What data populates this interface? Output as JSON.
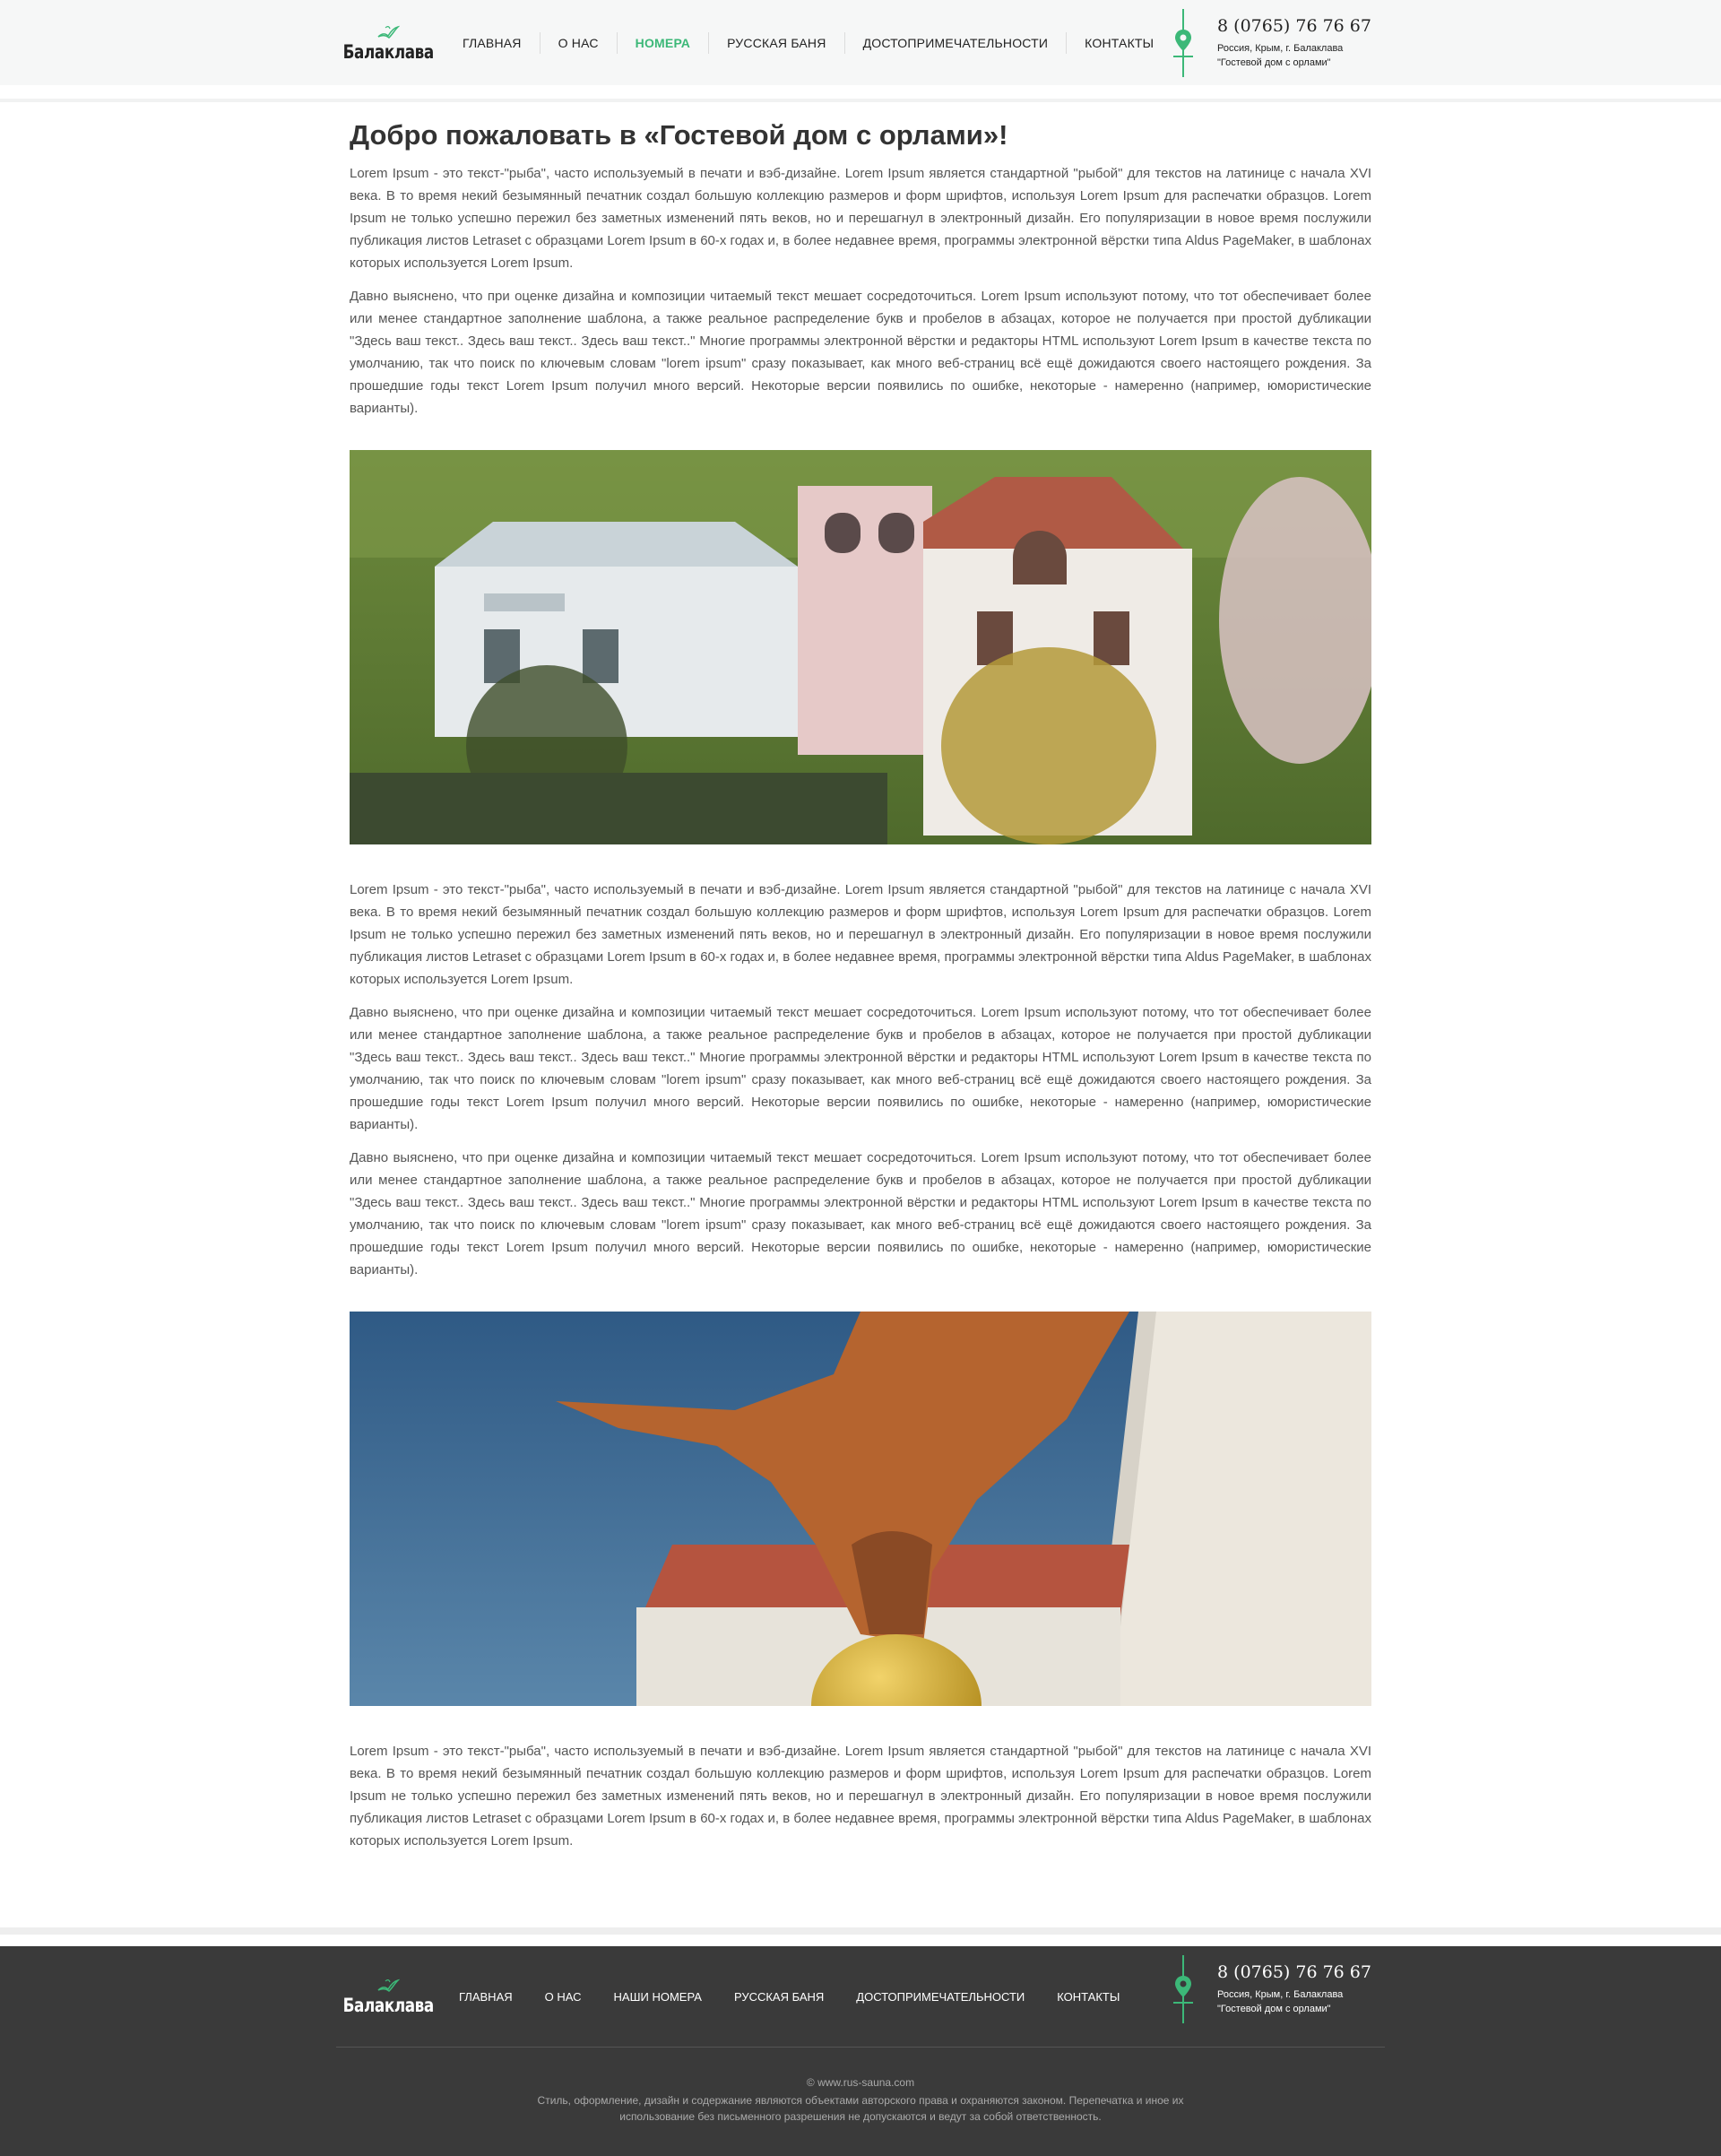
{
  "brand": {
    "logo_text": "Балаклава",
    "accent": "#3cb878"
  },
  "nav": {
    "items": [
      {
        "label": "ГЛАВНАЯ"
      },
      {
        "label": "О НАС"
      },
      {
        "label": "НОМЕРА",
        "active": true
      },
      {
        "label": "РУССКАЯ БАНЯ"
      },
      {
        "label": "ДОСТОПРИМЕЧАТЕЛЬНОСТИ"
      },
      {
        "label": "КОНТАКТЫ"
      }
    ]
  },
  "contact": {
    "phone": "8 (0765) 76 76 67",
    "address_line1": "Россия, Крым, г. Балаклава",
    "address_line2": "\"Гостевой дом с орлами\""
  },
  "main": {
    "title": "Добро пожаловать в «Гостевой дом с орлами»!",
    "p1": "Lorem Ipsum - это текст-\"рыба\", часто используемый в печати и вэб-дизайне. Lorem Ipsum является стандартной \"рыбой\" для текстов на латинице с начала XVI века. В то время некий безымянный печатник создал большую коллекцию размеров и форм шрифтов, используя Lorem Ipsum для распечатки образцов. Lorem Ipsum не только успешно пережил без заметных изменений пять веков, но и перешагнул в электронный дизайн. Его популяризации в новое время послужили публикация листов Letraset с образцами Lorem Ipsum в 60-х годах и, в более недавнее время, программы электронной вёрстки типа Aldus PageMaker, в шаблонах которых используется Lorem Ipsum.",
    "p2": "Давно выяснено, что при оценке дизайна и композиции читаемый текст мешает сосредоточиться. Lorem Ipsum используют потому, что тот обеспечивает более или менее стандартное заполнение шаблона, а также реальное распределение букв и пробелов в абзацах, которое не получается при простой дубликации \"Здесь ваш текст.. Здесь ваш текст.. Здесь ваш текст..\" Многие программы электронной вёрстки и редакторы HTML используют Lorem Ipsum в качестве текста по умолчанию, так что поиск по ключевым словам \"lorem ipsum\" сразу показывает, как много веб-страниц всё ещё дожидаются своего настоящего рождения. За прошедшие годы текст Lorem Ipsum получил много версий. Некоторые версии появились по ошибке, некоторые - намеренно (например, юмористические варианты).",
    "p3": "Lorem Ipsum - это текст-\"рыба\", часто используемый в печати и вэб-дизайне. Lorem Ipsum является стандартной \"рыбой\" для текстов на латинице с начала XVI века. В то время некий безымянный печатник создал большую коллекцию размеров и форм шрифтов, используя Lorem Ipsum для распечатки образцов. Lorem Ipsum не только успешно пережил без заметных изменений пять веков, но и перешагнул в электронный дизайн. Его популяризации в новое время послужили публикация листов Letraset с образцами Lorem Ipsum в 60-х годах и, в более недавнее время, программы электронной вёрстки типа Aldus PageMaker, в шаблонах которых используется Lorem Ipsum.",
    "p4": "Давно выяснено, что при оценке дизайна и композиции читаемый текст мешает сосредоточиться. Lorem Ipsum используют потому, что тот обеспечивает более или менее стандартное заполнение шаблона, а также реальное распределение букв и пробелов в абзацах, которое не получается при простой дубликации \"Здесь ваш текст.. Здесь ваш текст.. Здесь ваш текст..\" Многие программы электронной вёрстки и редакторы HTML используют Lorem Ipsum в качестве текста по умолчанию, так что поиск по ключевым словам \"lorem ipsum\" сразу показывает, как много веб-страниц всё ещё дожидаются своего настоящего рождения. За прошедшие годы текст Lorem Ipsum получил много версий. Некоторые версии появились по ошибке, некоторые - намеренно (например, юмористические варианты).",
    "p5": "Давно выяснено, что при оценке дизайна и композиции читаемый текст мешает сосредоточиться. Lorem Ipsum используют потому, что тот обеспечивает более или менее стандартное заполнение шаблона, а также реальное распределение букв и пробелов в абзацах, которое не получается при простой дубликации \"Здесь ваш текст.. Здесь ваш текст.. Здесь ваш текст..\" Многие программы электронной вёрстки и редакторы HTML используют Lorem Ipsum в качестве текста по умолчанию, так что поиск по ключевым словам \"lorem ipsum\" сразу показывает, как много веб-страниц всё ещё дожидаются своего настоящего рождения. За прошедшие годы текст Lorem Ipsum получил много версий. Некоторые версии появились по ошибке, некоторые - намеренно (например, юмористические варианты).",
    "p6": "Lorem Ipsum - это текст-\"рыба\", часто используемый в печати и вэб-дизайне. Lorem Ipsum является стандартной \"рыбой\" для текстов на латинице с начала XVI века. В то время некий безымянный печатник создал большую коллекцию размеров и форм шрифтов, используя Lorem Ipsum для распечатки образцов. Lorem Ipsum не только успешно пережил без заметных изменений пять веков, но и перешагнул в электронный дизайн. Его популяризации в новое время послужили публикация листов Letraset с образцами Lorem Ipsum в 60-х годах и, в более недавнее время, программы электронной вёрстки типа Aldus PageMaker, в шаблонах которых используется Lorem Ipsum."
  },
  "footer": {
    "nav": [
      {
        "label": "ГЛАВНАЯ"
      },
      {
        "label": "О НАС"
      },
      {
        "label": "НАШИ НОМЕРА"
      },
      {
        "label": "РУССКАЯ БАНЯ"
      },
      {
        "label": "ДОСТОПРИМЕЧАТЕЛЬНОСТИ"
      },
      {
        "label": "КОНТАКТЫ"
      }
    ],
    "copyright": "© www.rus-sauna.com",
    "rights": "Стиль, оформление, дизайн и содержание являются объектами авторского права и охраняются законом. Перепечатка и иное их использование без письменного разрешения не допускаются и ведут за собой ответственность."
  }
}
